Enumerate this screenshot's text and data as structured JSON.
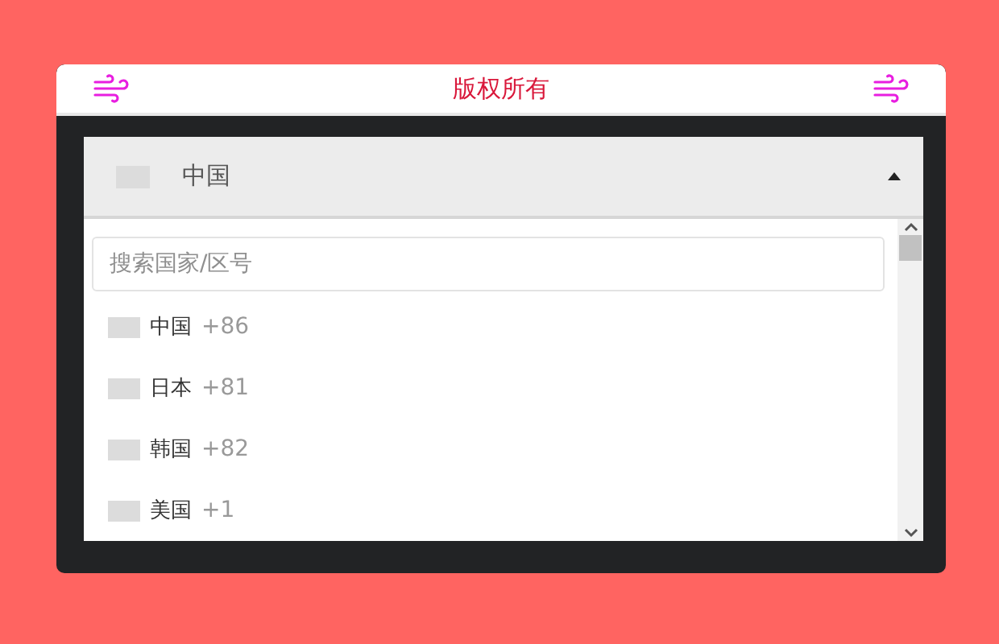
{
  "header": {
    "title": "版权所有"
  },
  "selector": {
    "value": "中国",
    "expanded": true
  },
  "search": {
    "placeholder": "搜索国家/区号"
  },
  "countries": [
    {
      "name": "中国",
      "code": "+86"
    },
    {
      "name": "日本",
      "code": "+81"
    },
    {
      "name": "韩国",
      "code": "+82"
    },
    {
      "name": "美国",
      "code": "+1"
    }
  ]
}
